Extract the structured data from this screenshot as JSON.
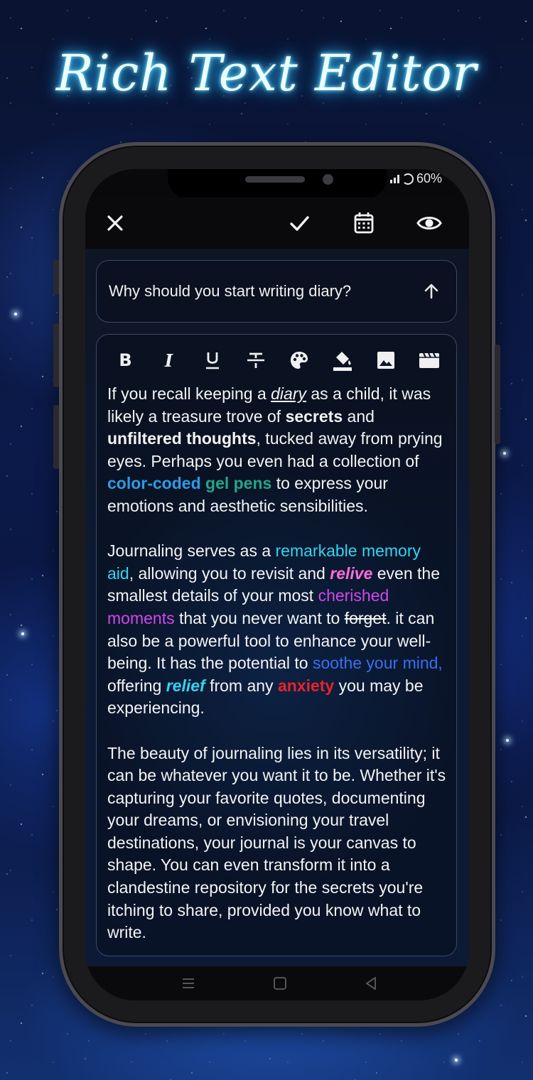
{
  "headline": "Rich Text Editor",
  "status_bar": {
    "battery": "60%"
  },
  "app_bar": {
    "icons": [
      "close-icon",
      "check-icon",
      "calendar-icon",
      "eye-icon"
    ]
  },
  "title_field": {
    "value": "Why should you start writing diary?"
  },
  "toolbar": {
    "buttons": [
      "bold",
      "italic",
      "underline",
      "strikethrough",
      "text-color",
      "highlight",
      "image",
      "video"
    ],
    "bold_label": "B",
    "italic_label": "I"
  },
  "editor": {
    "p1": {
      "t1": "If you recall keeping a ",
      "diary": "diary",
      "t2": " as a child, it was likely a treasure trove of ",
      "secrets": "secrets",
      "t3": " and ",
      "unfiltered": "unfiltered thoughts",
      "t4": ", tucked away from prying eyes. Perhaps you even had a collection of ",
      "color_coded": "color-coded",
      "t5": " ",
      "gel_pens": "gel pens",
      "t6": " to express your emotions and aesthetic sensibilities."
    },
    "p2": {
      "t1": "Journaling serves as a ",
      "memory": "remarkable memory aid",
      "t2": ", allowing you to revisit and ",
      "relive": "relive",
      "t3": " even the smallest details of your most ",
      "cherished": "cherished moments",
      "t4": " that you never want to ",
      "forget": "forget",
      "t5": ". it can also be a powerful tool to enhance your well-being. It has the potential to ",
      "soothe": "soothe your mind,",
      "t6": " offering ",
      "relief": "relief",
      "t7": " from any ",
      "anxiety": "anxiety",
      "t8": " you may be experiencing."
    },
    "p3": "The beauty of journaling lies in its versatility; it can be whatever you want it to be. Whether it's capturing your favorite quotes, documenting your dreams, or envisioning your travel destinations, your journal is your canvas to shape. You can even transform it into a clandestine repository for the secrets you're itching to share, provided you know what to write."
  },
  "colors": {
    "accent_blue": "#2e9be6",
    "green": "#24a58a",
    "cyan": "#34d4f0",
    "pink": "#ff6fd8",
    "magenta": "#d147ec",
    "royal": "#3a6ff0",
    "red": "#e8232a"
  }
}
